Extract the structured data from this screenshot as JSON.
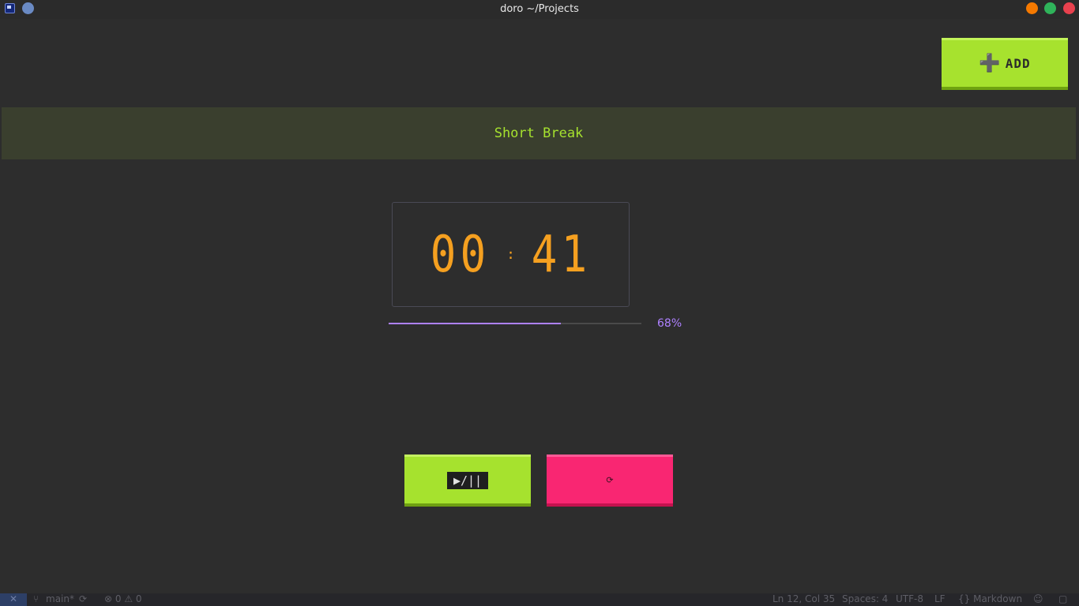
{
  "window": {
    "title": "doro ~/Projects"
  },
  "toolbar": {
    "add_icon": "plus-icon",
    "add_icon_glyph": "➕",
    "add_label": "ADD"
  },
  "mode": {
    "label": "Short Break"
  },
  "timer": {
    "minutes": "00",
    "separator": ":",
    "seconds": "41",
    "color": "#f5a020"
  },
  "progress": {
    "percent": 68,
    "label": "68%",
    "color": "#ae81ff"
  },
  "controls": {
    "play_pause_label": "▶/||",
    "reset_icon": "reset-icon",
    "reset_glyph": "⟳"
  },
  "statusbar": {
    "remote_glyph": "✕",
    "branch": "main*",
    "problems": "⊗ 0 ⚠ 0",
    "position": "Ln 12, Col 35",
    "spaces": "Spaces: 4",
    "encoding": "UTF-8",
    "eol": "LF",
    "language": "{} Markdown"
  },
  "colors": {
    "accent_green": "#a6e22e",
    "accent_pink": "#f92672",
    "background": "#2d2d2d"
  }
}
